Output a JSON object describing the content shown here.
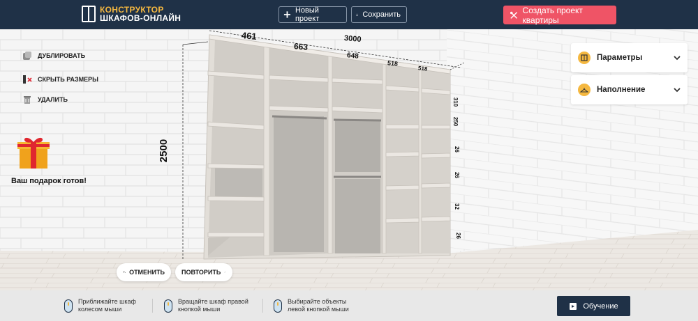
{
  "header": {
    "logo_line1": "КОНСТРУКТОР",
    "logo_line2": "ШКАФОВ-ОНЛАЙН",
    "new_project": "Новый проект",
    "save": "Сохранить",
    "create_apartment": "Создать проект квартиры"
  },
  "tools": {
    "duplicate": "ДУБЛИРОВАТЬ",
    "hide_sizes": "СКРЫТЬ РАЗМЕРЫ",
    "delete": "УДАЛИТЬ",
    "gift": "Ваш подарок готов!"
  },
  "history": {
    "undo": "ОТМЕНИТЬ",
    "redo": "ПОВТОРИТЬ"
  },
  "panels": {
    "params": "Параметры",
    "fill": "Наполнение"
  },
  "dimensions": {
    "height": "2500",
    "width_total": "3000",
    "section1": "461",
    "section2": "663",
    "section3": "648",
    "section4": "518",
    "section5": "518",
    "side_labels": [
      "310",
      "250",
      "26",
      "26",
      "32",
      "26"
    ]
  },
  "footer": {
    "hint1_line1": "Приближайте шкаф",
    "hint1_line2": "колесом мыши",
    "hint2_line1": "Вращайте шкаф правой",
    "hint2_line2": "кнопкой мыши",
    "hint3_line1": "Выбирайте объекты",
    "hint3_line2": "левой кнопкой мыши",
    "learn": "Обучение"
  },
  "colors": {
    "header_bg": "#1f3147",
    "accent_gold": "#f5b840",
    "create_btn": "#ef5466",
    "wardrobe": "#ddd9d3",
    "wall": "#f4f4f4",
    "floor": "#ece7e2"
  }
}
